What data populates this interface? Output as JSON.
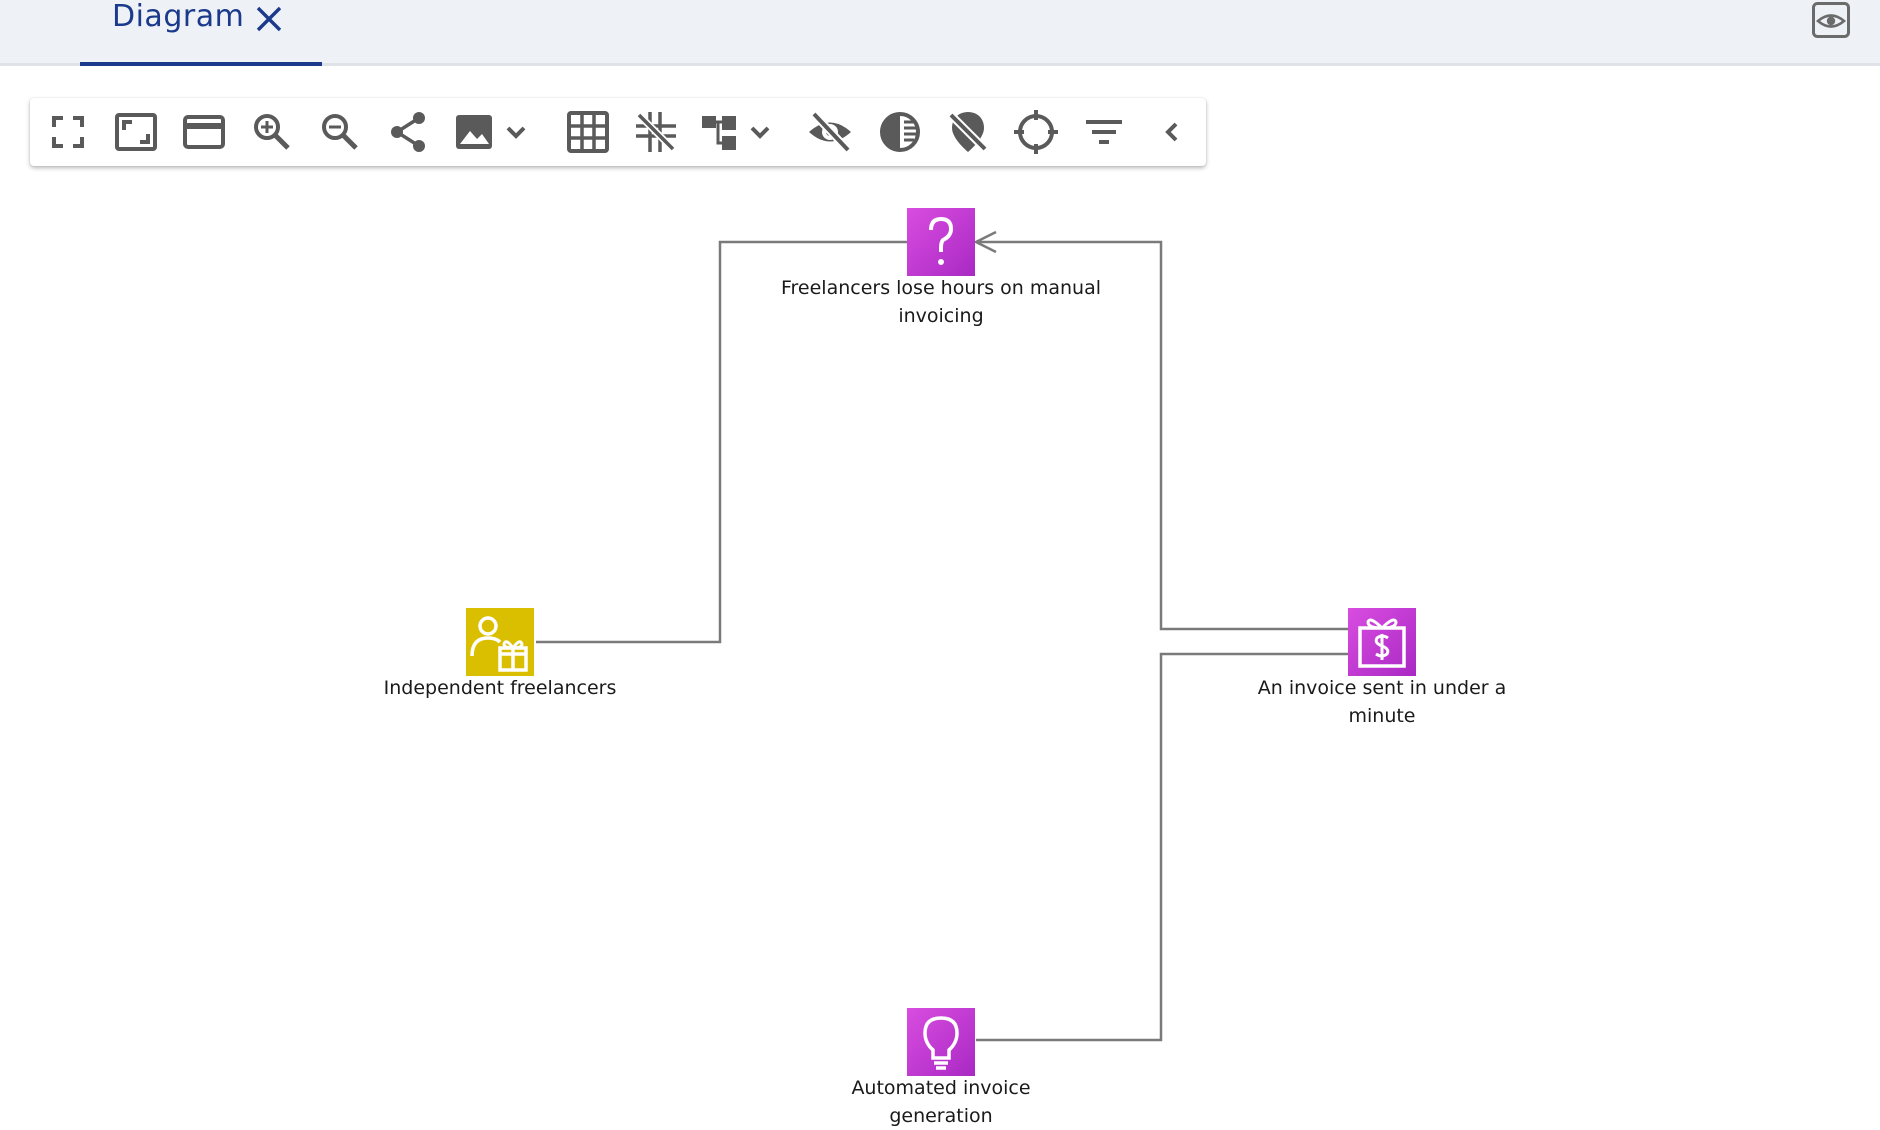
{
  "tab": {
    "label": "Diagram"
  },
  "toolbar": {
    "items": [
      "fullscreen-icon",
      "fit-to-screen-icon",
      "card-view-icon",
      "zoom-in-icon",
      "zoom-out-icon",
      "share-icon",
      "export-image-icon",
      "grid-icon",
      "snap-icon",
      "layout-icon",
      "hide-icon",
      "contrast-icon",
      "hide-location-icon",
      "center-icon",
      "filter-icon",
      "collapse-chevron-icon"
    ]
  },
  "nodes": {
    "problem": {
      "label": "Freelancers lose hours on manual invoicing",
      "color": "#c13bd6"
    },
    "segment": {
      "label": "Independent freelancers",
      "color": "#d9bf00"
    },
    "value": {
      "label": "An invoice sent in under a minute",
      "color": "#c13bd6"
    },
    "solution": {
      "label": "Automated invoice generation",
      "color": "#c13bd6"
    }
  },
  "colors": {
    "accent": "#1b3a8c",
    "icon": "#5a5a5a",
    "edge": "#7a7a7a"
  }
}
